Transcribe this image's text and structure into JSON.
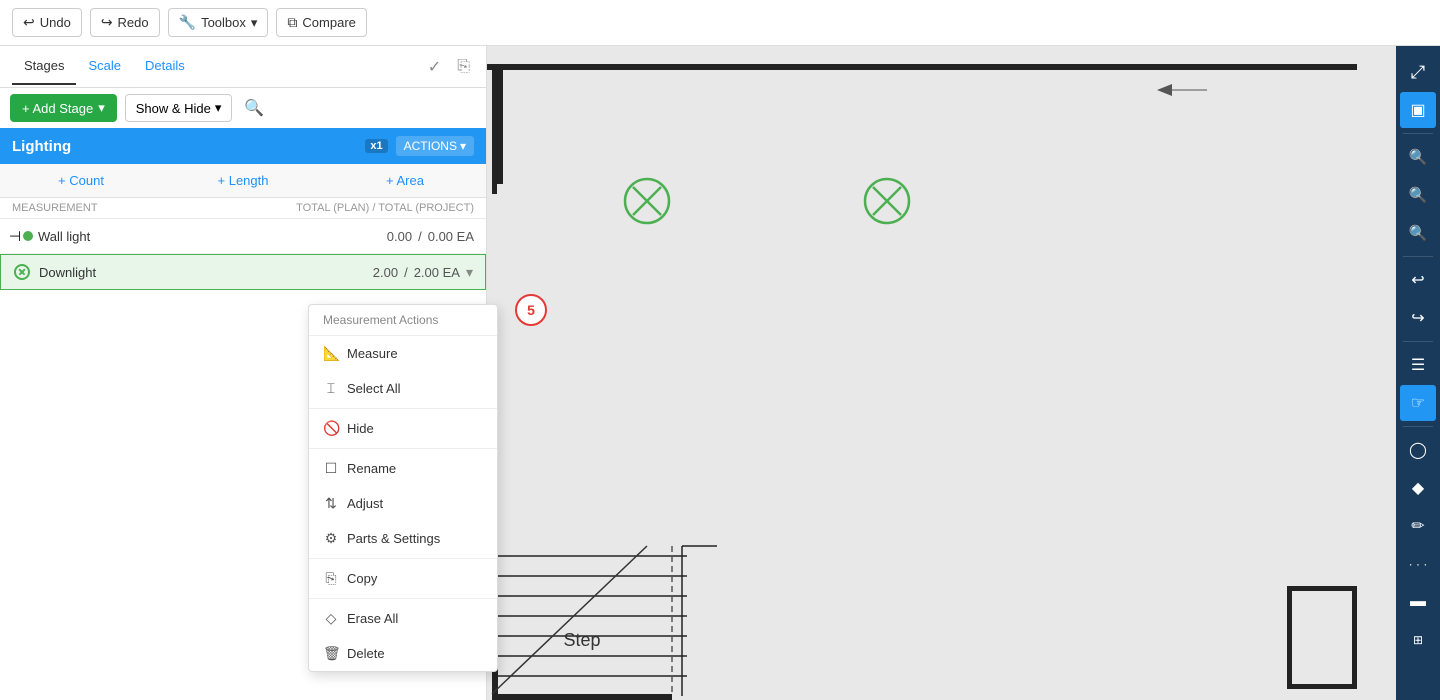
{
  "topbar": {
    "undo_label": "Undo",
    "redo_label": "Redo",
    "toolbox_label": "Toolbox",
    "compare_label": "Compare"
  },
  "tabs": {
    "stages_label": "Stages",
    "scale_label": "Scale",
    "details_label": "Details"
  },
  "panel": {
    "add_stage_label": "+ Add Stage",
    "show_hide_label": "Show & Hide",
    "stage_title": "Lighting",
    "x1_label": "x1",
    "actions_label": "ACTIONS",
    "count_label": "+ Count",
    "length_label": "+ Length",
    "area_label": "+ Area",
    "col_measurement": "MEASUREMENT",
    "col_totals": "TOTAL (PLAN) / TOTAL (PROJECT)",
    "measurements": [
      {
        "name": "Wall light",
        "type": "line",
        "value1": "0.00",
        "separator": "/",
        "value2": "0.00 EA"
      },
      {
        "name": "Downlight",
        "type": "circlex",
        "value1": "2.00",
        "separator": "/",
        "value2": "2.00 EA",
        "selected": true
      }
    ]
  },
  "context_menu": {
    "title": "Measurement Actions",
    "items": [
      {
        "icon": "ruler",
        "label": "Measure",
        "group": 1
      },
      {
        "icon": "cursor",
        "label": "Select All",
        "group": 1
      },
      {
        "icon": "hide",
        "label": "Hide",
        "group": 2
      },
      {
        "icon": "rename",
        "label": "Rename",
        "group": 3
      },
      {
        "icon": "adjust",
        "label": "Adjust",
        "group": 3
      },
      {
        "icon": "parts",
        "label": "Parts & Settings",
        "group": 3
      },
      {
        "icon": "copy",
        "label": "Copy",
        "group": 4
      },
      {
        "icon": "erase",
        "label": "Erase All",
        "group": 5
      },
      {
        "icon": "delete",
        "label": "Delete",
        "group": 5
      }
    ]
  },
  "step_badge": "5",
  "right_toolbar": {
    "icons": [
      "⤢",
      "▣",
      "🔍−",
      "🔍+",
      "🔍",
      "↩",
      "↪",
      "☰",
      "☞",
      "◯",
      "◆",
      "✏",
      "⋯",
      "▬",
      "⊞"
    ]
  }
}
